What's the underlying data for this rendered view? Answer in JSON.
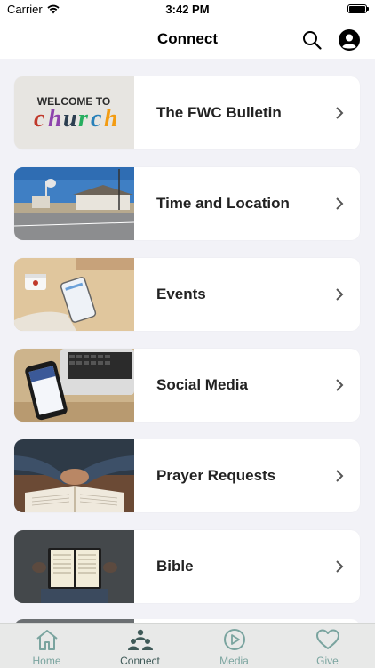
{
  "status": {
    "carrier": "Carrier",
    "time": "3:42 PM"
  },
  "nav": {
    "title": "Connect"
  },
  "items": [
    {
      "label": "The FWC Bulletin",
      "thumb_text": "WELCOME TO church"
    },
    {
      "label": "Time and Location"
    },
    {
      "label": "Events"
    },
    {
      "label": "Social Media"
    },
    {
      "label": "Prayer Requests"
    },
    {
      "label": "Bible"
    }
  ],
  "tabs": [
    {
      "label": "Home",
      "icon": "home-icon"
    },
    {
      "label": "Connect",
      "icon": "people-icon",
      "active": true
    },
    {
      "label": "Media",
      "icon": "play-icon"
    },
    {
      "label": "Give",
      "icon": "heart-icon"
    }
  ],
  "colors": {
    "tab_inactive": "#7aa49f",
    "tab_active": "#3f5a58",
    "background": "#f2f2f7"
  }
}
